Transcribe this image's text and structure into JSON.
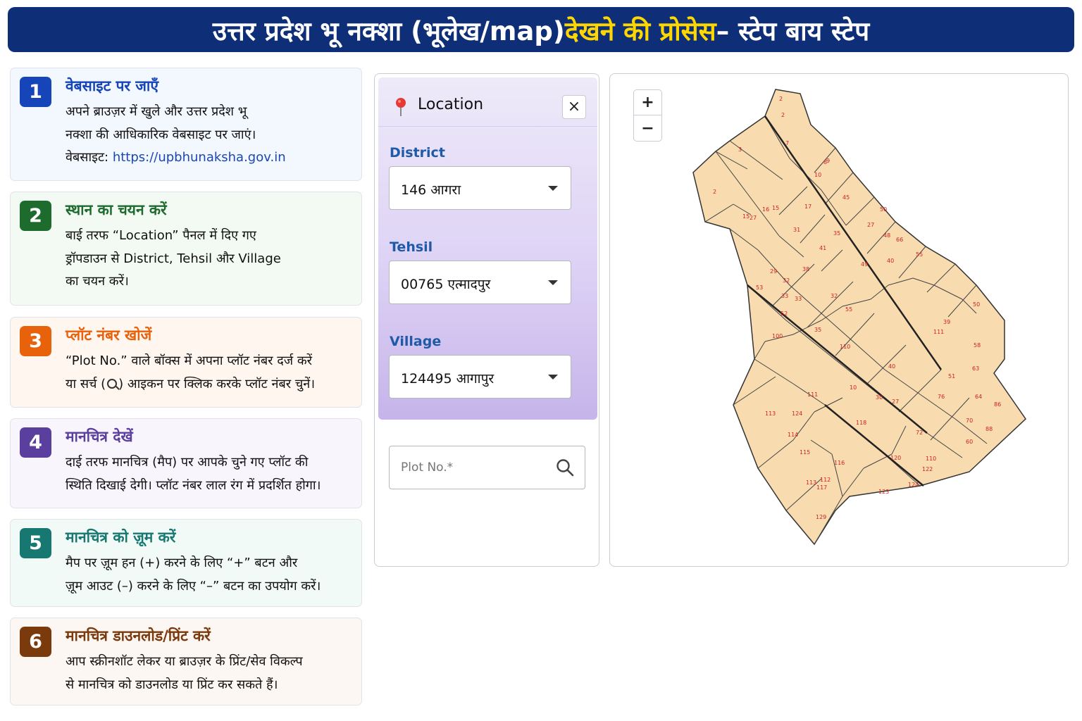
{
  "banner": {
    "title_part1": "उत्तर प्रदेश भू नक्शा (भूलेख/map) ",
    "title_highlight": "देखने की प्रोसेस",
    "title_part2": " – स्टेप बाय स्टेप"
  },
  "colors": {
    "banner_bg": "#0e2f78",
    "highlight": "#ffd700",
    "step1": "#1545b8",
    "step2": "#1e6b2e",
    "step3": "#e8620c",
    "step4": "#5b3f9e",
    "step5": "#177872",
    "step6": "#7a3a0c",
    "plot_fill": "#f8dcb0",
    "plot_label": "#d02020"
  },
  "steps": [
    {
      "number": "1",
      "title": "वेबसाइट पर जाएँ",
      "lines": [
        "अपने ब्राउज़र में खुले और उत्तर प्रदेश भू",
        "नक्शा की आधिकारिक वेबसाइट पर जाएं।"
      ],
      "link_prefix": "वेबसाइट: ",
      "link": "https://upbhunaksha.gov.in"
    },
    {
      "number": "2",
      "title": "स्थान का चयन करें",
      "lines": [
        "बाई तरफ “Location” पैनल में दिए गए",
        "ड्रॉपडाउन से District, Tehsil और Village",
        "का चयन करें।"
      ]
    },
    {
      "number": "3",
      "title": "प्लॉट नंबर खोजें",
      "lines": [
        "“Plot No.” वाले बॉक्स में अपना प्लॉट नंबर दर्ज करें"
      ],
      "line2_a": "या सर्च (",
      "line2_b": ") आइकन पर क्लिक करके प्लॉट नंबर चुनें।"
    },
    {
      "number": "4",
      "title": "मानचित्र देखें",
      "lines": [
        "दाई तरफ मानचित्र (मैप) पर आपके चुने गए प्लॉट की",
        "स्थिति दिखाई देगी। प्लॉट नंबर लाल रंग में प्रदर्शित होगा।"
      ]
    },
    {
      "number": "5",
      "title": "मानचित्र को ज़ूम करें",
      "lines": [
        "मैप पर ज़ूम हन (+) करने के लिए “+” बटन और",
        "ज़ूम आउट (–) करने के लिए “–” बटन का उपयोग करें।"
      ]
    },
    {
      "number": "6",
      "title": "मानचित्र डाउनलोड/प्रिंट करें",
      "lines": [
        "आप स्क्रीनशॉट लेकर या ब्राउज़र के प्रिंट/सेव विकल्प",
        "से मानचित्र को डाउनलोड या प्रिंट कर सकते हैं।"
      ]
    }
  ],
  "location_panel": {
    "title": "Location",
    "close_icon": "×",
    "district": {
      "label": "District",
      "value": "146 आगरा"
    },
    "tehsil": {
      "label": "Tehsil",
      "value": "00765 एत्मादपुर"
    },
    "village": {
      "label": "Village",
      "value": "124495 आगापुर"
    },
    "plot": {
      "placeholder": "Plot No.*"
    }
  },
  "map": {
    "zoom_in": "+",
    "zoom_out": "−",
    "plot_labels": [
      "2",
      "2",
      "3",
      "7",
      "8",
      "9",
      "10",
      "2",
      "15",
      "16",
      "15",
      "27",
      "17",
      "45",
      "50",
      "27",
      "35",
      "41",
      "31",
      "48",
      "66",
      "55",
      "49",
      "40",
      "29",
      "32",
      "38",
      "33",
      "33",
      "53",
      "32",
      "55",
      "52",
      "100",
      "35",
      "110",
      "111",
      "39",
      "50",
      "58",
      "63",
      "64",
      "51",
      "40",
      "10",
      "111",
      "113",
      "124",
      "114",
      "115",
      "116",
      "118",
      "30",
      "27",
      "76",
      "86",
      "72",
      "70",
      "88",
      "60",
      "120",
      "110",
      "122",
      "124",
      "123",
      "129",
      "112",
      "113",
      "117"
    ]
  }
}
